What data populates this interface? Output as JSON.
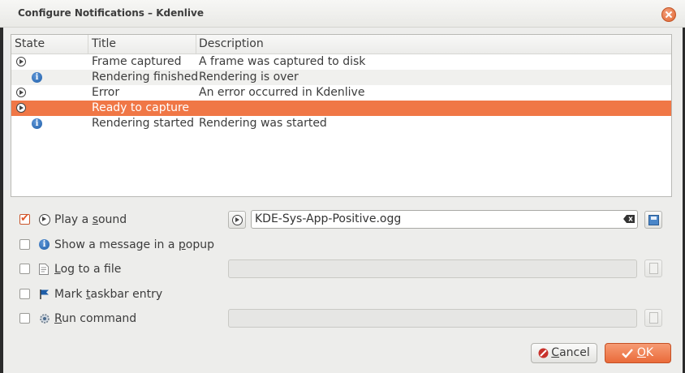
{
  "window": {
    "title": "Configure Notifications – Kdenlive"
  },
  "table": {
    "headers": [
      "State",
      "Title",
      "Description"
    ],
    "rows": [
      {
        "icon": "play-icon",
        "title": "Frame captured",
        "description": "A frame was captured to disk"
      },
      {
        "icon": "info-icon",
        "title": "Rendering finished",
        "description": "Rendering is over"
      },
      {
        "icon": "play-icon",
        "title": "Error",
        "description": "An error occurred in Kdenlive"
      },
      {
        "icon": "play-icon",
        "title": "Ready to capture",
        "description": ""
      },
      {
        "icon": "info-icon",
        "title": "Rendering started",
        "description": "Rendering was started"
      }
    ],
    "selected_index": 3
  },
  "options": {
    "play_sound": {
      "label_pre": "Play a ",
      "label_u": "s",
      "label_post": "ound",
      "checked": true
    },
    "show_popup": {
      "label_pre": "Show a message in a ",
      "label_u": "p",
      "label_post": "opup",
      "checked": false
    },
    "log_file": {
      "label_pre": "",
      "label_u": "L",
      "label_post": "og to a file",
      "checked": false
    },
    "mark_taskbar": {
      "label_pre": "Mark ",
      "label_u": "t",
      "label_post": "askbar entry",
      "checked": false
    },
    "run_command": {
      "label_pre": "",
      "label_u": "R",
      "label_post": "un command",
      "checked": false
    }
  },
  "sound_file": {
    "value": "KDE-Sys-App-Positive.ogg"
  },
  "buttons": {
    "cancel_u": "C",
    "cancel_rest": "ancel",
    "ok_u": "O",
    "ok_rest": "K"
  },
  "colors": {
    "accent": "#f07746",
    "info": "#1f5ea8"
  }
}
